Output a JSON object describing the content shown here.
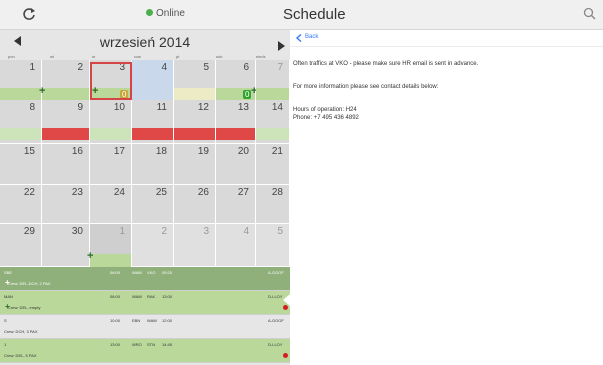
{
  "topbar": {
    "online": "Online",
    "title": "Schedule"
  },
  "calendar": {
    "month": "wrzesień 2014",
    "weekdays": [
      "pon",
      "wt",
      "śr",
      "czw",
      "pt",
      "sob",
      "niedz"
    ],
    "days": [
      [
        "1",
        "2",
        "3",
        "4",
        "5",
        "6",
        "7"
      ],
      [
        "8",
        "9",
        "10",
        "11",
        "12",
        "13",
        "14"
      ],
      [
        "15",
        "16",
        "17",
        "18",
        "19",
        "20",
        "21"
      ],
      [
        "22",
        "23",
        "24",
        "25",
        "26",
        "27",
        "28"
      ],
      [
        "29",
        "30",
        "1",
        "2",
        "3",
        "4",
        "5"
      ]
    ],
    "badge_wed": "0",
    "badge_sun": "0"
  },
  "flights": [
    {
      "a": "SBE",
      "b": "06:00",
      "c": "WAW",
      "d": "VKO",
      "e": "09:20",
      "f": "A-GOOF",
      "sub": "Crew: DEL-DCH, 2 PAX"
    },
    {
      "a": "MAN",
      "b": "08:00",
      "c": "WAW",
      "d": "RAK",
      "e": "13:00",
      "f": "D-LLOY",
      "sub": "Crew: DEL, empty"
    },
    {
      "a": "S",
      "b": "10:00",
      "c": "EBN",
      "d": "WAW",
      "e": "12:00",
      "f": "A-GOOF",
      "sub": "Crew: DCH, 3 PAX"
    },
    {
      "a": "1",
      "b": "13:00",
      "c": "WRO",
      "d": "STN",
      "e": "14:45",
      "f": "D-LLOY",
      "sub": "Crew: DEL, 5 PAX"
    }
  ],
  "detail": {
    "back": "Back",
    "line1": "Often traffics at VKO - please make sure HR email is sent in advance.",
    "line2": "For more information please see contact details below:",
    "line3": "Hours of operation: H24",
    "line4": "Phone: +7 495 436 4892"
  },
  "colors": {
    "accent": "#3478f6",
    "online": "#4cae4c",
    "green": "#b9d89a",
    "red": "#e04848",
    "today_border": "#d64545"
  },
  "icons": {
    "refresh": "refresh-icon",
    "search": "search-icon",
    "online": "status-dot-icon",
    "back": "chevron-left-icon"
  }
}
